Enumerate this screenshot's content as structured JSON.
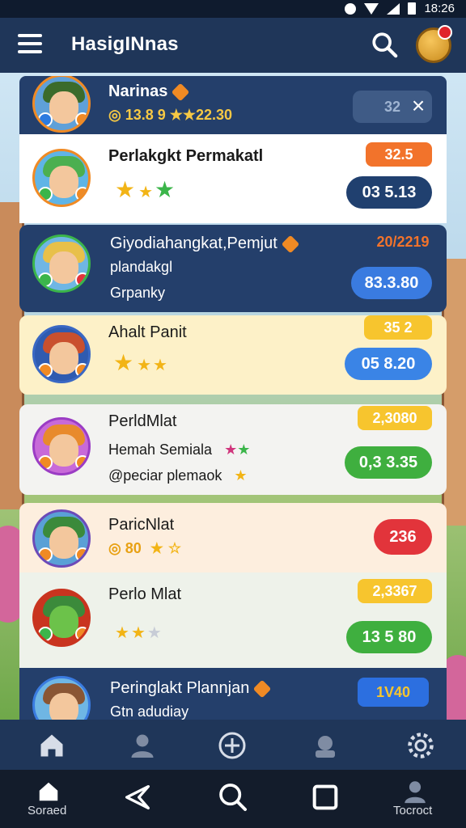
{
  "status_bar": {
    "time": "18:26"
  },
  "app_bar": {
    "title": "HasigINnas"
  },
  "list": [
    {
      "name": "Narinas",
      "sub": "◎ 13.8 9 ★★22.30",
      "badge": "32",
      "close": "×"
    },
    {
      "name": "Perlakgkt Permakatl",
      "tag": "32.5",
      "button": "03 5.13"
    },
    {
      "name": "Giyodiahangkat,Pemjut",
      "sub1": "plandakgl",
      "sub2": "Grpanky",
      "tag": "20/2219",
      "button": "83.3.80"
    },
    {
      "name": "Ahalt Panit",
      "tag": "35 2",
      "button": "05 8.20"
    },
    {
      "name": "PerldMlat",
      "sub1": "Hemah Semiala",
      "sub2": "@peciar plemaok",
      "tag": "2,3080",
      "button": "0,3 3.35"
    },
    {
      "name": "ParicNlat",
      "sub": "◎ 80",
      "button": "236"
    },
    {
      "name": "Perlo Mlat",
      "tag": "2,3367",
      "button": "13 5 80"
    },
    {
      "name": "Peringlakt Plannjan",
      "sub": "Gtn adudiay",
      "tag": "1V40"
    }
  ],
  "system_nav": {
    "left_label": "Soraed",
    "right_label": "Tocroct"
  },
  "colors": {
    "primary_dark": "#1f3659",
    "card_dark": "#243f6b",
    "orange": "#f2732b",
    "blue_pill": "#3a7be0",
    "green_pill": "#3faf3f",
    "red_pill": "#e2343b",
    "gold": "#f2b416"
  },
  "icons": [
    "menu-icon",
    "search-icon",
    "coin-icon",
    "home-icon",
    "profile-icon",
    "add-icon",
    "shop-icon",
    "settings-icon",
    "back-icon",
    "recents-icon"
  ]
}
